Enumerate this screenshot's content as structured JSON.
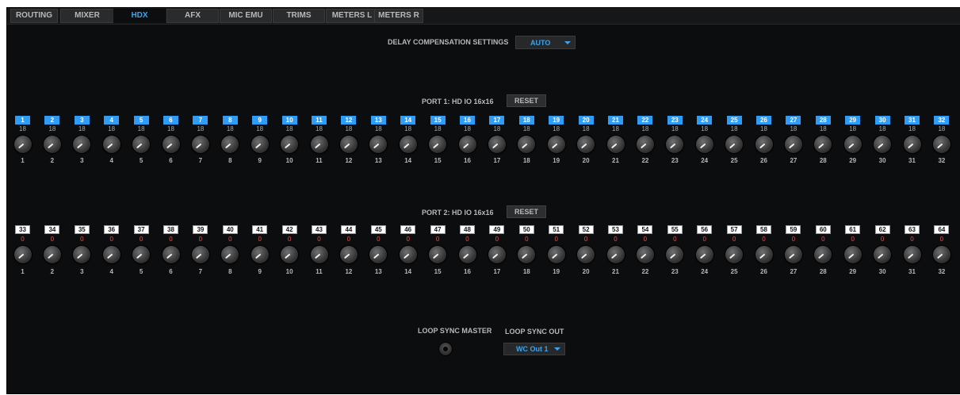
{
  "tabs": [
    {
      "label": "ROUTING",
      "active": false
    },
    {
      "label": "MIXER",
      "active": false
    },
    {
      "label": "HDX",
      "active": true
    },
    {
      "label": "AFX",
      "active": false
    },
    {
      "label": "MIC EMU",
      "active": false
    },
    {
      "label": "TRIMS",
      "active": false
    },
    {
      "label": "METERS L",
      "active": false
    },
    {
      "label": "METERS R",
      "active": false
    }
  ],
  "delay_compensation": {
    "label": "DELAY COMPENSATION SETTINGS",
    "value": "AUTO"
  },
  "port1": {
    "label": "PORT 1:  HD IO 16x16",
    "reset_label": "RESET",
    "channels": [
      "1",
      "2",
      "3",
      "4",
      "5",
      "6",
      "7",
      "8",
      "9",
      "10",
      "11",
      "12",
      "13",
      "14",
      "15",
      "16",
      "17",
      "18",
      "19",
      "20",
      "21",
      "22",
      "23",
      "24",
      "25",
      "26",
      "27",
      "28",
      "29",
      "30",
      "31",
      "32"
    ],
    "delays": [
      "18",
      "18",
      "18",
      "18",
      "18",
      "18",
      "18",
      "18",
      "18",
      "18",
      "18",
      "18",
      "18",
      "18",
      "18",
      "18",
      "18",
      "18",
      "18",
      "18",
      "18",
      "18",
      "18",
      "18",
      "18",
      "18",
      "18",
      "18",
      "18",
      "18",
      "18",
      "18"
    ],
    "knob_numbers": [
      "1",
      "2",
      "3",
      "4",
      "5",
      "6",
      "7",
      "8",
      "9",
      "10",
      "11",
      "12",
      "13",
      "14",
      "15",
      "16",
      "17",
      "18",
      "19",
      "20",
      "21",
      "22",
      "23",
      "24",
      "25",
      "26",
      "27",
      "28",
      "29",
      "30",
      "31",
      "32"
    ]
  },
  "port2": {
    "label": "PORT 2:  HD IO 16x16",
    "reset_label": "RESET",
    "channels": [
      "33",
      "34",
      "35",
      "36",
      "37",
      "38",
      "39",
      "40",
      "41",
      "42",
      "43",
      "44",
      "45",
      "46",
      "47",
      "48",
      "49",
      "50",
      "51",
      "52",
      "53",
      "54",
      "55",
      "56",
      "57",
      "58",
      "59",
      "60",
      "61",
      "62",
      "63",
      "64"
    ],
    "delays": [
      "0",
      "0",
      "0",
      "0",
      "0",
      "0",
      "0",
      "0",
      "0",
      "0",
      "0",
      "0",
      "0",
      "0",
      "0",
      "0",
      "0",
      "0",
      "0",
      "0",
      "0",
      "0",
      "0",
      "0",
      "0",
      "0",
      "0",
      "0",
      "0",
      "0",
      "0",
      "0"
    ],
    "knob_numbers": [
      "1",
      "2",
      "3",
      "4",
      "5",
      "6",
      "7",
      "8",
      "9",
      "10",
      "11",
      "12",
      "13",
      "14",
      "15",
      "16",
      "17",
      "18",
      "19",
      "20",
      "21",
      "22",
      "23",
      "24",
      "25",
      "26",
      "27",
      "28",
      "29",
      "30",
      "31",
      "32"
    ]
  },
  "loop_sync": {
    "master_label": "LOOP SYNC MASTER",
    "out_label": "LOOP SYNC OUT",
    "out_value": "WC Out 1"
  },
  "colors": {
    "accent": "#3da3ee",
    "channel_active": "#2f9df5",
    "delay_zero": "#e25046",
    "background": "#0c0d0e"
  }
}
